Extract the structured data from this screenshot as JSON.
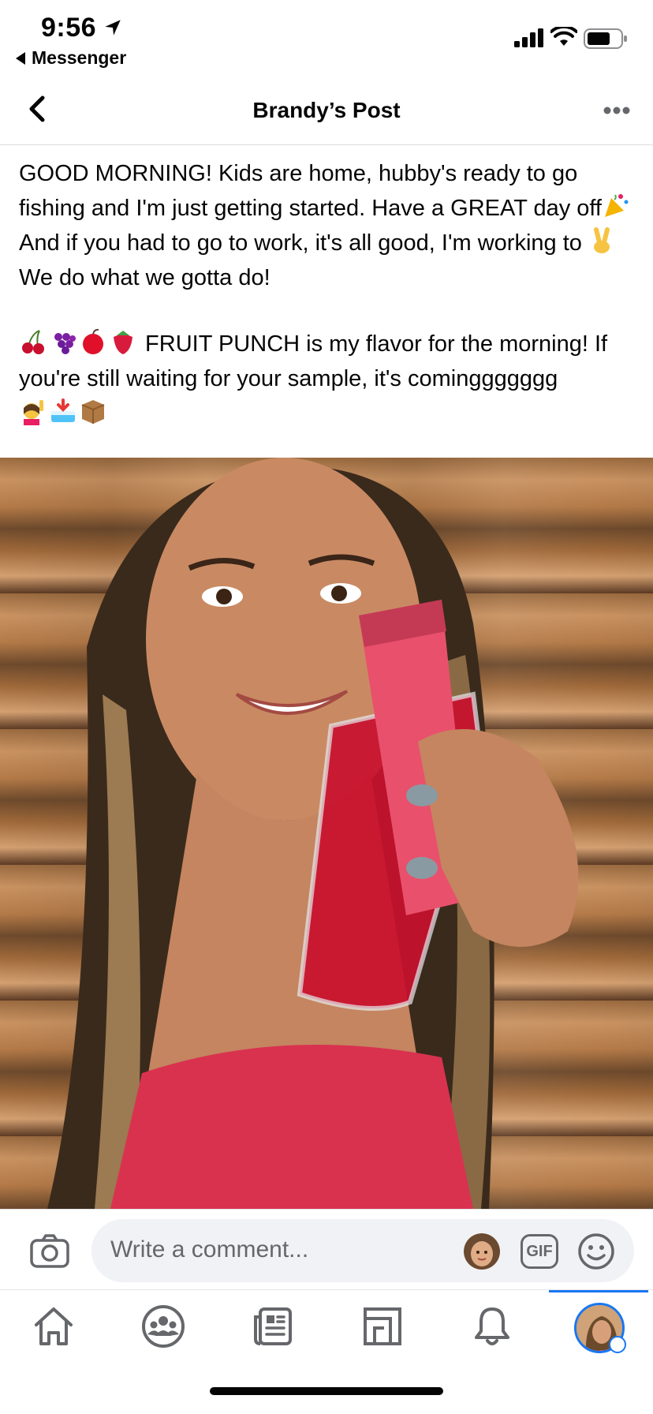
{
  "status_bar": {
    "time": "9:56",
    "back_app_label": "Messenger"
  },
  "nav": {
    "title": "Brandy’s Post"
  },
  "post": {
    "line1": "GOOD MORNING! Kids are home, hubby's ready to go fishing and I'm just getting started. Have a GREAT day off",
    "line1b": " And if you had to go to work, it's all good, I'm working to ",
    "line1c": " We do what we gotta do!",
    "line2": " FRUIT PUNCH is my flavor for the morning! If you're still waiting for your sample, it's cominggggggg",
    "emojis": {
      "party": "party-popper-emoji",
      "peace": "victory-hand-emoji",
      "fruits": [
        "cherries-emoji",
        "grapes-emoji",
        "apple-emoji",
        "strawberry-emoji"
      ],
      "trailing": [
        "raising-hand-emoji",
        "inbox-tray-emoji",
        "package-emoji"
      ]
    }
  },
  "photo": {
    "alt_subject": "woman holding red drink and pink packet"
  },
  "comment_bar": {
    "placeholder": "Write a comment...",
    "gif_label": "GIF"
  },
  "tabs": [
    {
      "name": "home",
      "icon": "home-icon"
    },
    {
      "name": "groups",
      "icon": "groups-icon"
    },
    {
      "name": "news",
      "icon": "news-icon"
    },
    {
      "name": "marketplace",
      "icon": "marketplace-icon"
    },
    {
      "name": "notifications",
      "icon": "bell-icon"
    },
    {
      "name": "profile",
      "icon": "profile-avatar",
      "active": true
    }
  ],
  "colors": {
    "accent": "#1877f2",
    "secondary_text": "#65676b",
    "input_bg": "#f0f2f5"
  }
}
